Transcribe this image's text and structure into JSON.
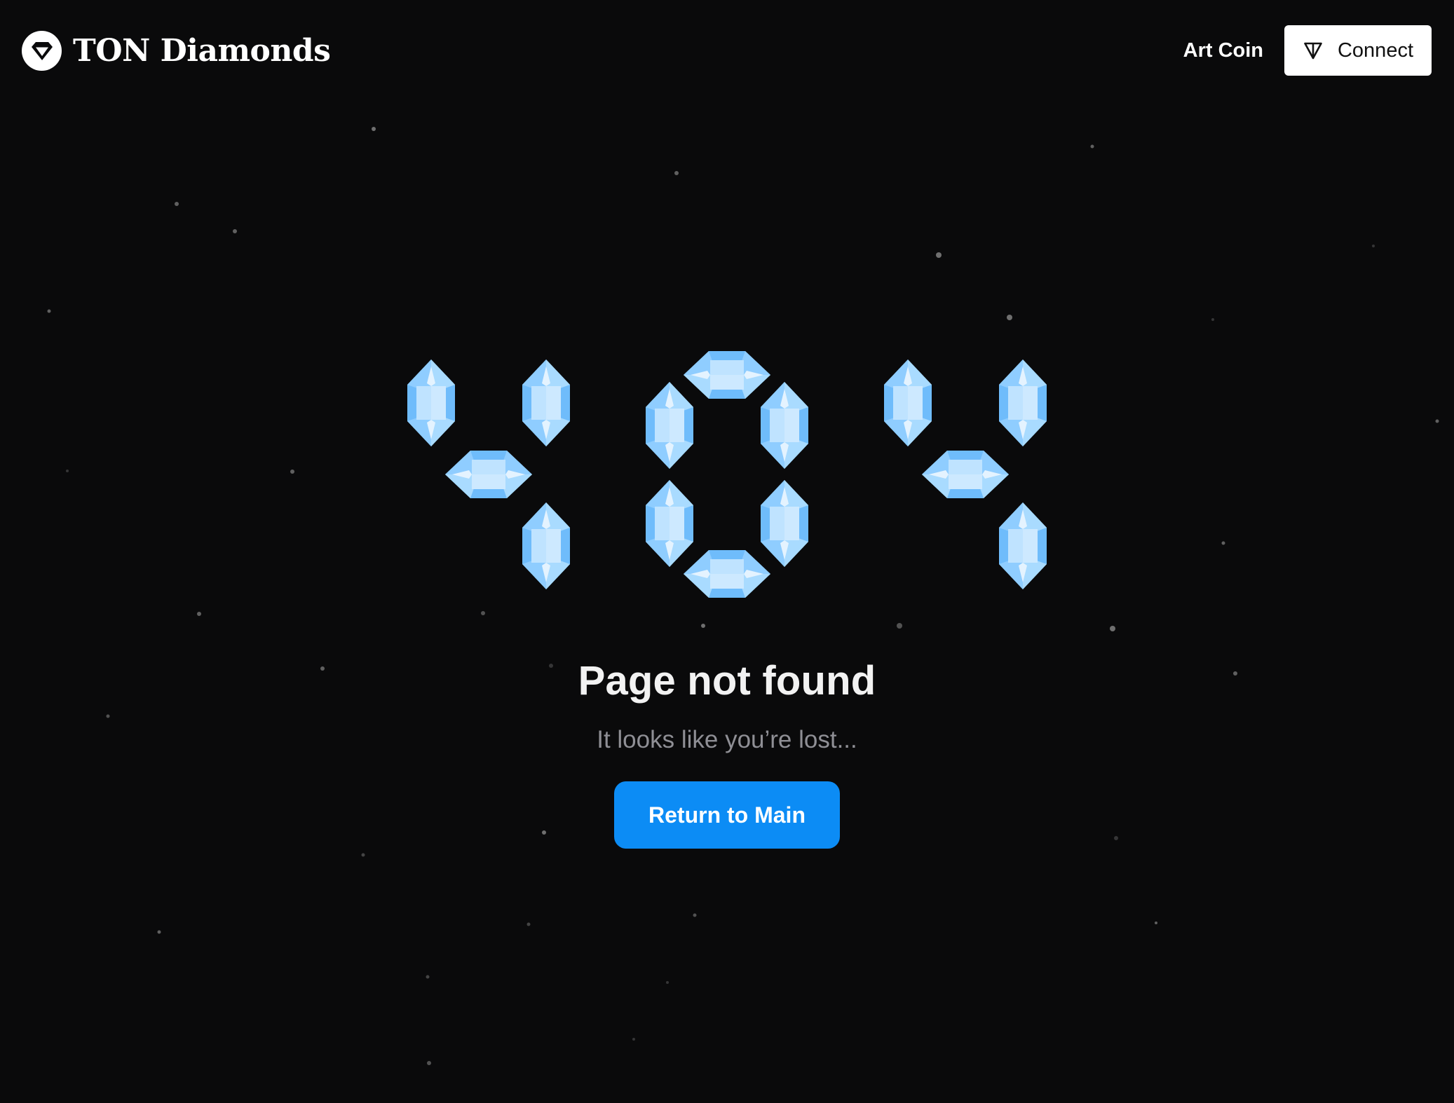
{
  "header": {
    "brand": "TON Diamonds",
    "nav_link": "Art Coin",
    "connect_label": "Connect"
  },
  "error": {
    "code": "404",
    "title": "Page not found",
    "subtitle": "It looks like you’re lost...",
    "return_label": "Return to Main"
  },
  "icons": {
    "brand_logo": "diamond-icon",
    "connect": "ton-icon",
    "digit_segments": "crystal-icon"
  },
  "colors": {
    "background": "#0a0a0b",
    "accent": "#0c8cf5",
    "crystal": "#7cc4ff",
    "crystal_light": "#cde9ff"
  }
}
